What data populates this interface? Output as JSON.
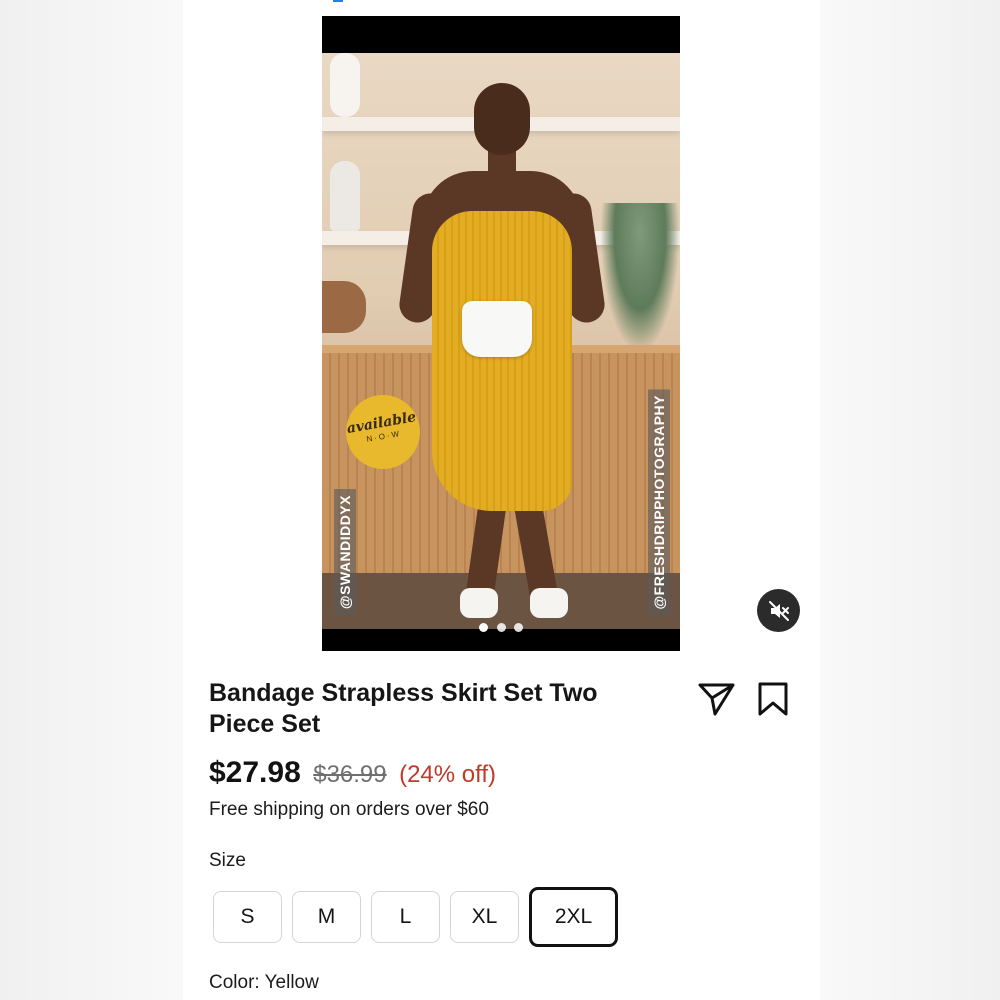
{
  "media": {
    "badge_text": "available",
    "badge_subtext": "N·O·W",
    "watermark_left": "@SWANDIDDYX",
    "watermark_right": "@FRESHDRIPPHOTOGRAPHY",
    "carousel_dots": 3,
    "mute_icon": "speaker-muted-icon"
  },
  "product": {
    "title": "Bandage Strapless Skirt Set Two Piece Set",
    "price": "$27.98",
    "original_price": "$36.99",
    "discount": "(24% off)",
    "shipping_note": "Free shipping on orders over $60",
    "size_label": "Size",
    "sizes": [
      "S",
      "M",
      "L",
      "XL",
      "2XL"
    ],
    "selected_size": "2XL",
    "color_label": "Color: Yellow"
  },
  "actions": {
    "share_icon": "send-icon",
    "save_icon": "bookmark-icon"
  },
  "colors": {
    "discount": "#c0392b",
    "dress": "#e3ad23",
    "text": "#161616"
  }
}
